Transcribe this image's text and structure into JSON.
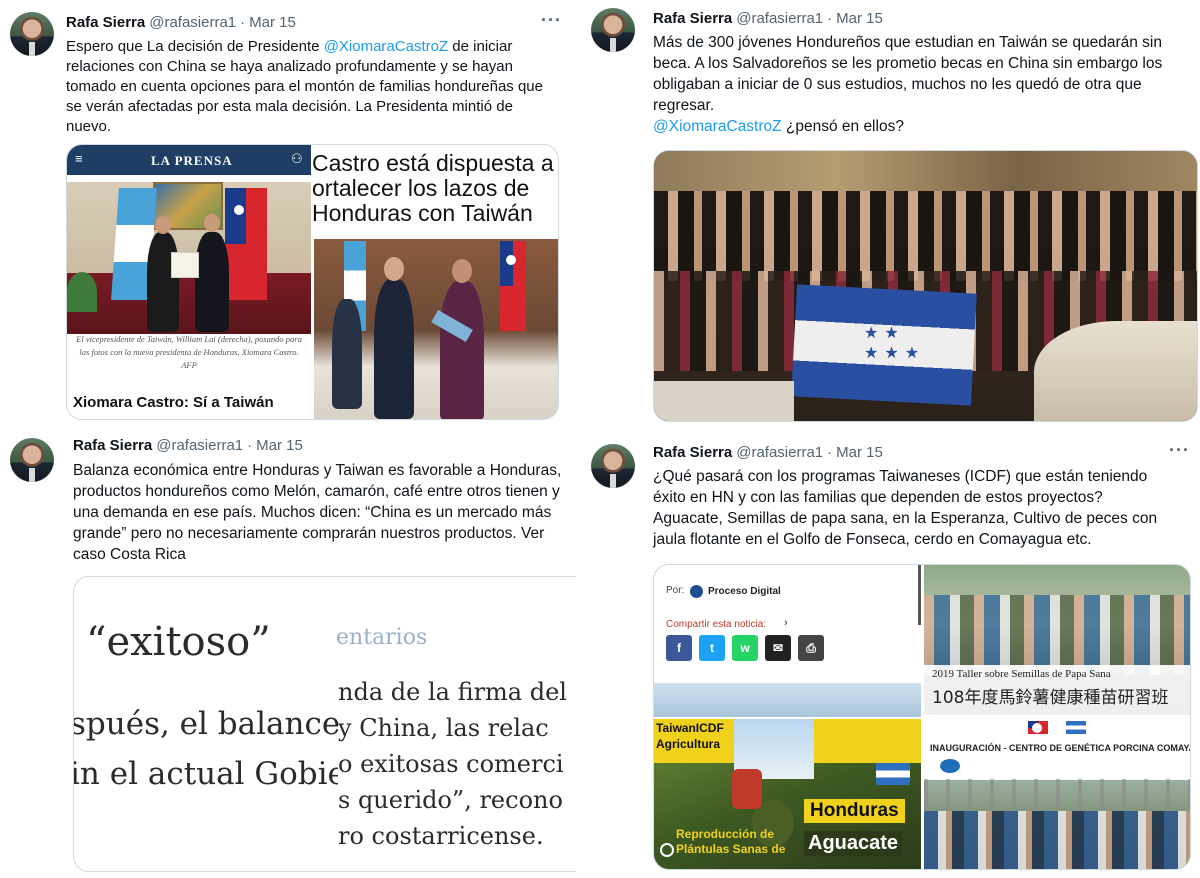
{
  "tweets": [
    {
      "author": {
        "name": "Rafa Sierra",
        "handle": "@rafasierra1",
        "date": "Mar 15"
      },
      "text_lines": [
        {
          "before": "Espero que La decisión de Presidente ",
          "mention": "@XiomaraCastroZ",
          "after": " de iniciar"
        },
        {
          "before": "relaciones con China se haya analizado profundamente y se hayan",
          "mention": "",
          "after": ""
        },
        {
          "before": "tomado en cuenta opciones para el montón de familias hondureñas que",
          "mention": "",
          "after": ""
        },
        {
          "before": "se verán afectadas por esta mala decisión. La Presidenta mintió de",
          "mention": "",
          "after": ""
        },
        {
          "before": "nuevo.",
          "mention": "",
          "after": ""
        }
      ],
      "media": {
        "site_name": "LA PRENSA",
        "menu_icon": "hamburger-icon",
        "user_icon": "user-icon",
        "caption": "El vicepresidente de Taiwán, William Lai (derecha), posando para las fotos con la nueva presidenta de Honduras, Xiomara Castro. AFP",
        "headline_left": "Xiomara Castro: Sí a Taiwán",
        "headline_right": [
          "Castro está dispuesta a",
          "ortalecer los lazos de",
          "Honduras con Taiwán"
        ]
      }
    },
    {
      "author": {
        "name": "Rafa Sierra",
        "handle": "@rafasierra1",
        "date": "Mar 15"
      },
      "text_lines": [
        {
          "before": "Más de 300 jóvenes Hondureños que estudian en Taiwán se quedarán sin",
          "mention": "",
          "after": ""
        },
        {
          "before": "beca. A los Salvadoreños se les prometio becas en China sin embargo los",
          "mention": "",
          "after": ""
        },
        {
          "before": "obligaban a iniciar de 0 sus estudios, muchos no les quedó de otra que",
          "mention": "",
          "after": ""
        },
        {
          "before": "regresar.",
          "mention": "",
          "after": ""
        },
        {
          "before": "",
          "mention": "@XiomaraCastroZ",
          "after": " ¿pensó en ellos?"
        }
      ]
    },
    {
      "author": {
        "name": "Rafa Sierra",
        "handle": "@rafasierra1",
        "date": "Mar 15"
      },
      "text_lines": [
        {
          "before": "Balanza económica entre Honduras y Taiwan es favorable a Honduras,",
          "mention": "",
          "after": ""
        },
        {
          "before": "productos hondureños como Melón, camarón, café entre otros tienen y",
          "mention": "",
          "after": ""
        },
        {
          "before": "una demanda en ese país. Muchos dicen: “China es un mercado más",
          "mention": "",
          "after": ""
        },
        {
          "before": "grande” pero no necesariamente comprarán nuestros productos. Ver",
          "mention": "",
          "after": ""
        },
        {
          "before": "caso Costa Rica",
          "mention": "",
          "after": ""
        }
      ],
      "media": {
        "quote_word": "“exitoso”",
        "faded_word": "entarios",
        "left_lines": [
          "spués, el balance",
          "in el actual Gobie"
        ],
        "right_lines": [
          "nda de la firma del",
          "y China, las relac",
          "o exitosas comerci",
          "s querido”, recono",
          "ro costarricense."
        ]
      }
    },
    {
      "author": {
        "name": "Rafa Sierra",
        "handle": "@rafasierra1",
        "date": "Mar 15"
      },
      "text_lines": [
        {
          "before": "¿Qué pasará con los programas Taiwaneses (ICDF) que están teniendo",
          "mention": "",
          "after": ""
        },
        {
          "before": "éxito en HN y con las familias que dependen de estos proyectos?",
          "mention": "",
          "after": ""
        },
        {
          "before": "Aguacate, Semillas de papa sana, en la Esperanza, Cultivo de peces con",
          "mention": "",
          "after": ""
        },
        {
          "before": "jaula flotante en el Golfo de Fonseca, cerdo en Comayagua etc.",
          "mention": "",
          "after": ""
        }
      ],
      "media": {
        "por_label": "Por:",
        "source": "Proceso Digital",
        "share_label": "Compartir esta noticia:",
        "share_icons": [
          {
            "icon": "facebook-icon",
            "glyph": "f",
            "color": "#3b5998"
          },
          {
            "icon": "twitter-icon",
            "glyph": "t",
            "color": "#1da1f2"
          },
          {
            "icon": "whatsapp-icon",
            "glyph": "w",
            "color": "#25d366"
          },
          {
            "icon": "email-icon",
            "glyph": "✉",
            "color": "#222222"
          },
          {
            "icon": "print-icon",
            "glyph": "⎙",
            "color": "#444444"
          }
        ],
        "icdf_line1": "TaiwanICDF",
        "icdf_line2": "Agricultura",
        "aguacate_top": "Reproducción de",
        "aguacate_bottom": "Plántulas Sanas de",
        "badge_honduras": "Honduras",
        "badge_aguacate": "Aguacate",
        "banner_title": "2019 Taller sobre Semillas de Papa Sana",
        "banner_chinese": "108年度馬鈴薯健康種苗研習班",
        "inaug_title": "INAUGURACIÓN - CENTRO DE GENÉTICA PORCINA COMAYAGUA"
      }
    }
  ],
  "more_icon": "···"
}
